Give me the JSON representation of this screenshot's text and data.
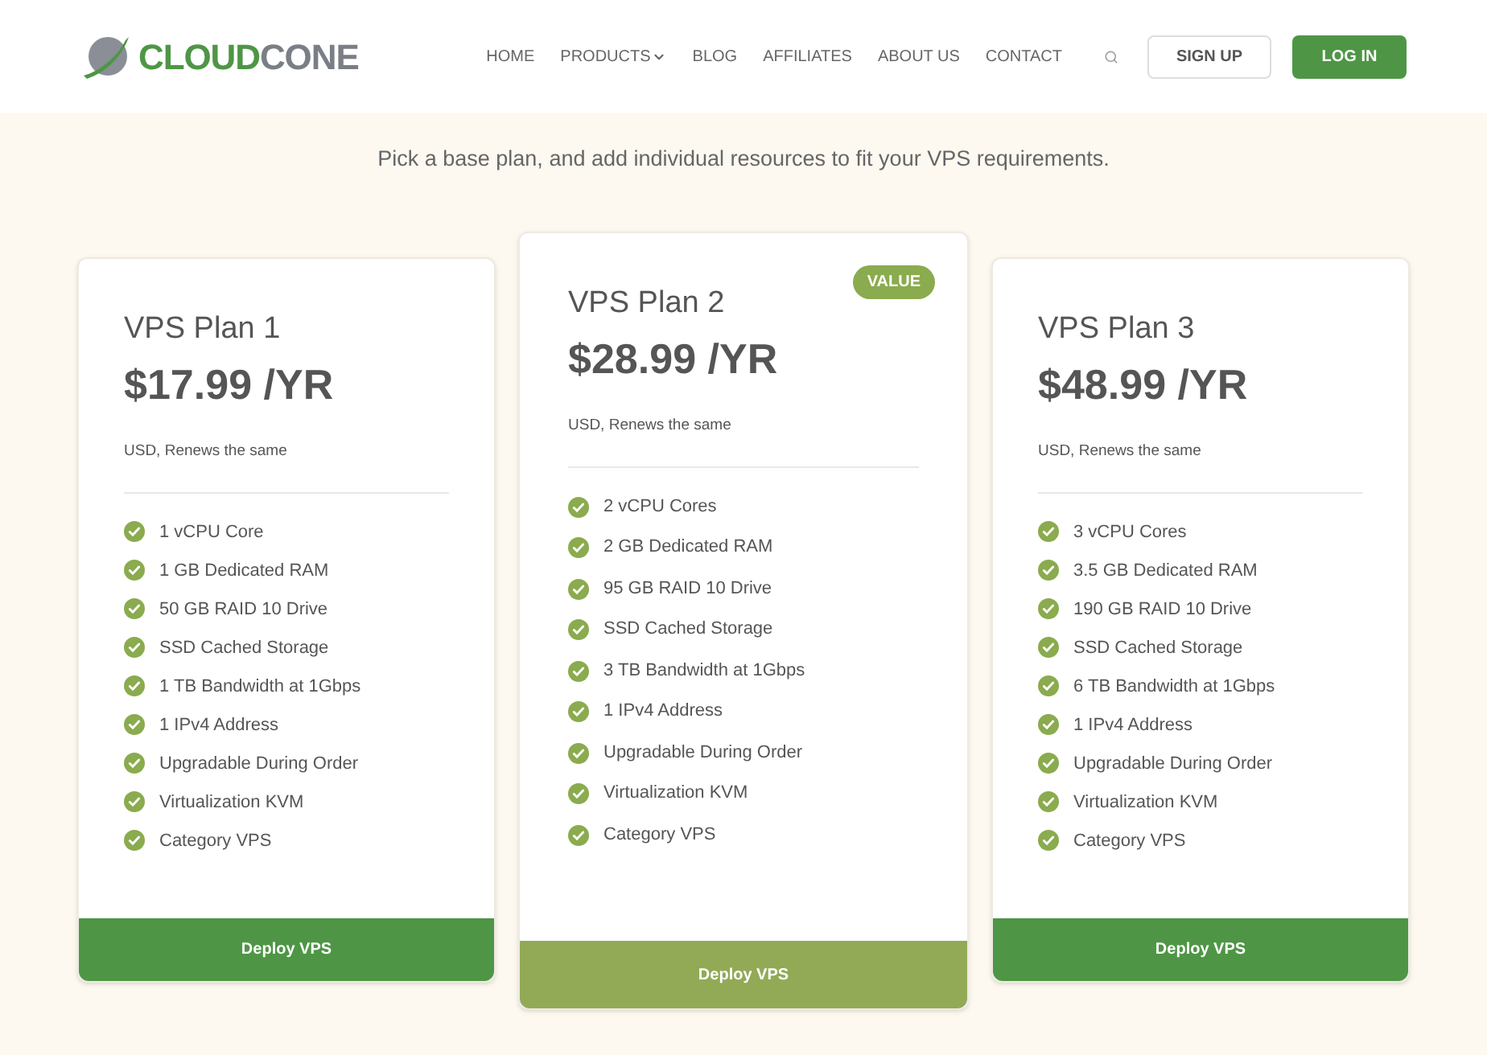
{
  "header": {
    "logo": [
      "CLOUD",
      "CONE"
    ],
    "nav": [
      {
        "label": "HOME",
        "has_menu": false
      },
      {
        "label": "PRODUCTS",
        "has_menu": true
      },
      {
        "label": "BLOG",
        "has_menu": false
      },
      {
        "label": "AFFILIATES",
        "has_menu": false
      },
      {
        "label": "ABOUT US",
        "has_menu": false
      },
      {
        "label": "CONTACT",
        "has_menu": false
      }
    ],
    "sign_up": "SIGN UP",
    "log_in": "LOG IN"
  },
  "tagline": "Pick a base plan, and add individual resources to fit your VPS requirements.",
  "plans": [
    {
      "name": "VPS Plan 1",
      "price": "$17.99 /YR",
      "note": "USD, Renews the same",
      "featured": false,
      "features": [
        "1 vCPU Core",
        "1 GB Dedicated RAM",
        "50 GB RAID 10 Drive",
        "SSD Cached Storage",
        "1 TB Bandwidth at 1Gbps",
        "1 IPv4 Address",
        "Upgradable During Order",
        "Virtualization KVM",
        "Category VPS"
      ],
      "button": "Deploy VPS"
    },
    {
      "name": "VPS Plan 2",
      "price": "$28.99 /YR",
      "note": "USD, Renews the same",
      "featured": true,
      "badge": "VALUE",
      "features": [
        "2 vCPU Cores",
        "2 GB Dedicated RAM",
        "95 GB RAID 10 Drive",
        "SSD Cached Storage",
        "3 TB Bandwidth at 1Gbps",
        "1 IPv4 Address",
        "Upgradable During Order",
        "Virtualization KVM",
        "Category VPS"
      ],
      "button": "Deploy VPS"
    },
    {
      "name": "VPS Plan 3",
      "price": "$48.99 /YR",
      "note": "USD, Renews the same",
      "featured": false,
      "features": [
        "3 vCPU Cores",
        "3.5 GB Dedicated RAM",
        "190 GB RAID 10 Drive",
        "SSD Cached Storage",
        "6 TB Bandwidth at 1Gbps",
        "1 IPv4 Address",
        "Upgradable During Order",
        "Virtualization KVM",
        "Category VPS"
      ],
      "button": "Deploy VPS"
    }
  ]
}
